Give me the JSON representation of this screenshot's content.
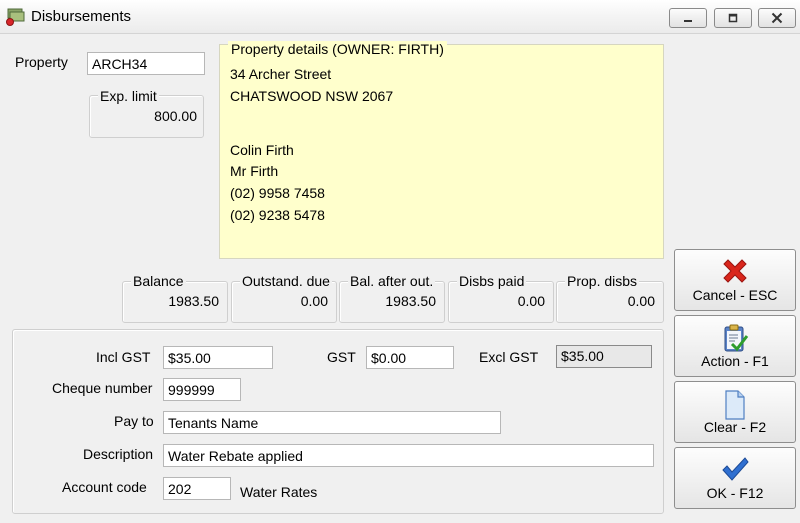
{
  "window": {
    "title": "Disbursements"
  },
  "property": {
    "label": "Property",
    "code": "ARCH34",
    "exp_limit_label": "Exp. limit",
    "exp_limit_value": "800.00"
  },
  "details": {
    "caption": "Property details  (OWNER:  FIRTH)",
    "lines": [
      "34 Archer Street",
      "CHATSWOOD  NSW  2067",
      "",
      "Colin Firth",
      "Mr Firth",
      "(02) 9958 7458",
      "(02) 9238 5478"
    ]
  },
  "summary": [
    {
      "label": "Balance",
      "value": "1983.50"
    },
    {
      "label": "Outstand. due",
      "value": "0.00"
    },
    {
      "label": "Bal. after out.",
      "value": "1983.50"
    },
    {
      "label": "Disbs paid",
      "value": "0.00"
    },
    {
      "label": "Prop. disbs",
      "value": "0.00"
    }
  ],
  "form": {
    "incl_gst_label": "Incl GST",
    "incl_gst_value": "$35.00",
    "gst_label": "GST",
    "gst_value": "$0.00",
    "excl_gst_label": "Excl GST",
    "excl_gst_value": "$35.00",
    "cheque_label": "Cheque number",
    "cheque_value": "999999",
    "pay_to_label": "Pay to",
    "pay_to_value": "Tenants Name",
    "description_label": "Description",
    "description_value": "Water Rebate applied",
    "account_code_label": "Account code",
    "account_code_value": "202",
    "account_name": "Water Rates"
  },
  "actions": {
    "cancel": {
      "label": "Cancel - ESC",
      "icon": "red-x-icon",
      "color": "#d9261c"
    },
    "action": {
      "label": "Action - F1",
      "icon": "clipboard-check-icon"
    },
    "clear": {
      "label": "Clear - F2",
      "icon": "blank-document-icon"
    },
    "ok": {
      "label": "OK - F12",
      "icon": "checkmark-icon",
      "color": "#2f6fd0"
    }
  }
}
